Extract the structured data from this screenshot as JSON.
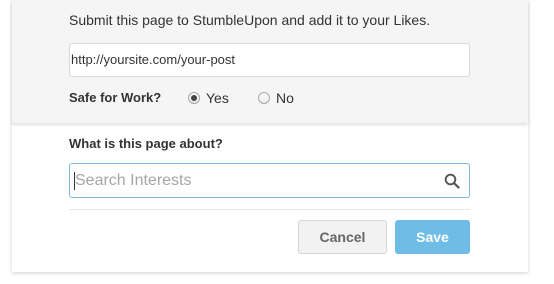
{
  "submit_panel": {
    "intro_text": "Submit this page to StumbleUpon and add it to your Likes.",
    "url_value": "http://yoursite.com/your-post",
    "safe_for_work": {
      "label": "Safe for Work?",
      "options": [
        {
          "label": "Yes",
          "checked": true
        },
        {
          "label": "No",
          "checked": false
        }
      ]
    }
  },
  "interests": {
    "question": "What is this page about?",
    "search_placeholder": "Search Interests",
    "search_value": ""
  },
  "actions": {
    "cancel_label": "Cancel",
    "save_label": "Save"
  },
  "colors": {
    "accent": "#6fbde6",
    "focus_border": "#7fb6d9",
    "panel_bg": "#f5f5f5"
  }
}
